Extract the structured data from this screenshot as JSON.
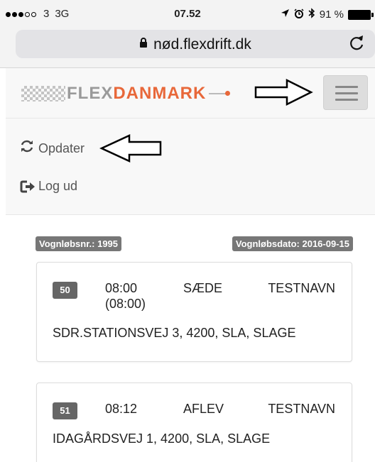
{
  "status_bar": {
    "carrier": "3",
    "network": "3G",
    "time": "07.52",
    "battery": "91 %",
    "icons": [
      "location-arrow-icon",
      "alarm-icon",
      "bluetooth-icon",
      "battery-icon"
    ]
  },
  "browser": {
    "url": "nød.flexdrift.dk",
    "lock_icon": "lock-icon",
    "reload_icon": "reload-icon"
  },
  "navbar": {
    "logo_part1": "FLEX",
    "logo_part2": "DANMARK",
    "menu_icon": "hamburger-menu-icon"
  },
  "menu": {
    "items": [
      {
        "label": "Opdater",
        "icon": "refresh-icon"
      },
      {
        "label": "Log ud",
        "icon": "sign-out-icon"
      }
    ]
  },
  "trip": {
    "number_label": "Vognløbsnr.: 1995",
    "date_label": "Vognløbsdato: 2016-09-15"
  },
  "stops": [
    {
      "badge": "50",
      "time": "08:00",
      "time_planned": "(08:00)",
      "type": "SÆDE",
      "name": "TESTNAVN",
      "address": "SDR.STATIONSVEJ 3, 4200, SLA, SLAGE"
    },
    {
      "badge": "51",
      "time": "08:12",
      "time_planned": "",
      "type": "AFLEV",
      "name": "TESTNAVN",
      "address": "IDAGÅRDSVEJ 1, 4200, SLA, SLAGE"
    }
  ],
  "colors": {
    "brand_orange": "#e8683a",
    "label_gray": "#777777",
    "badge_gray": "#666666",
    "navbar_bg": "#f8f8f8"
  }
}
